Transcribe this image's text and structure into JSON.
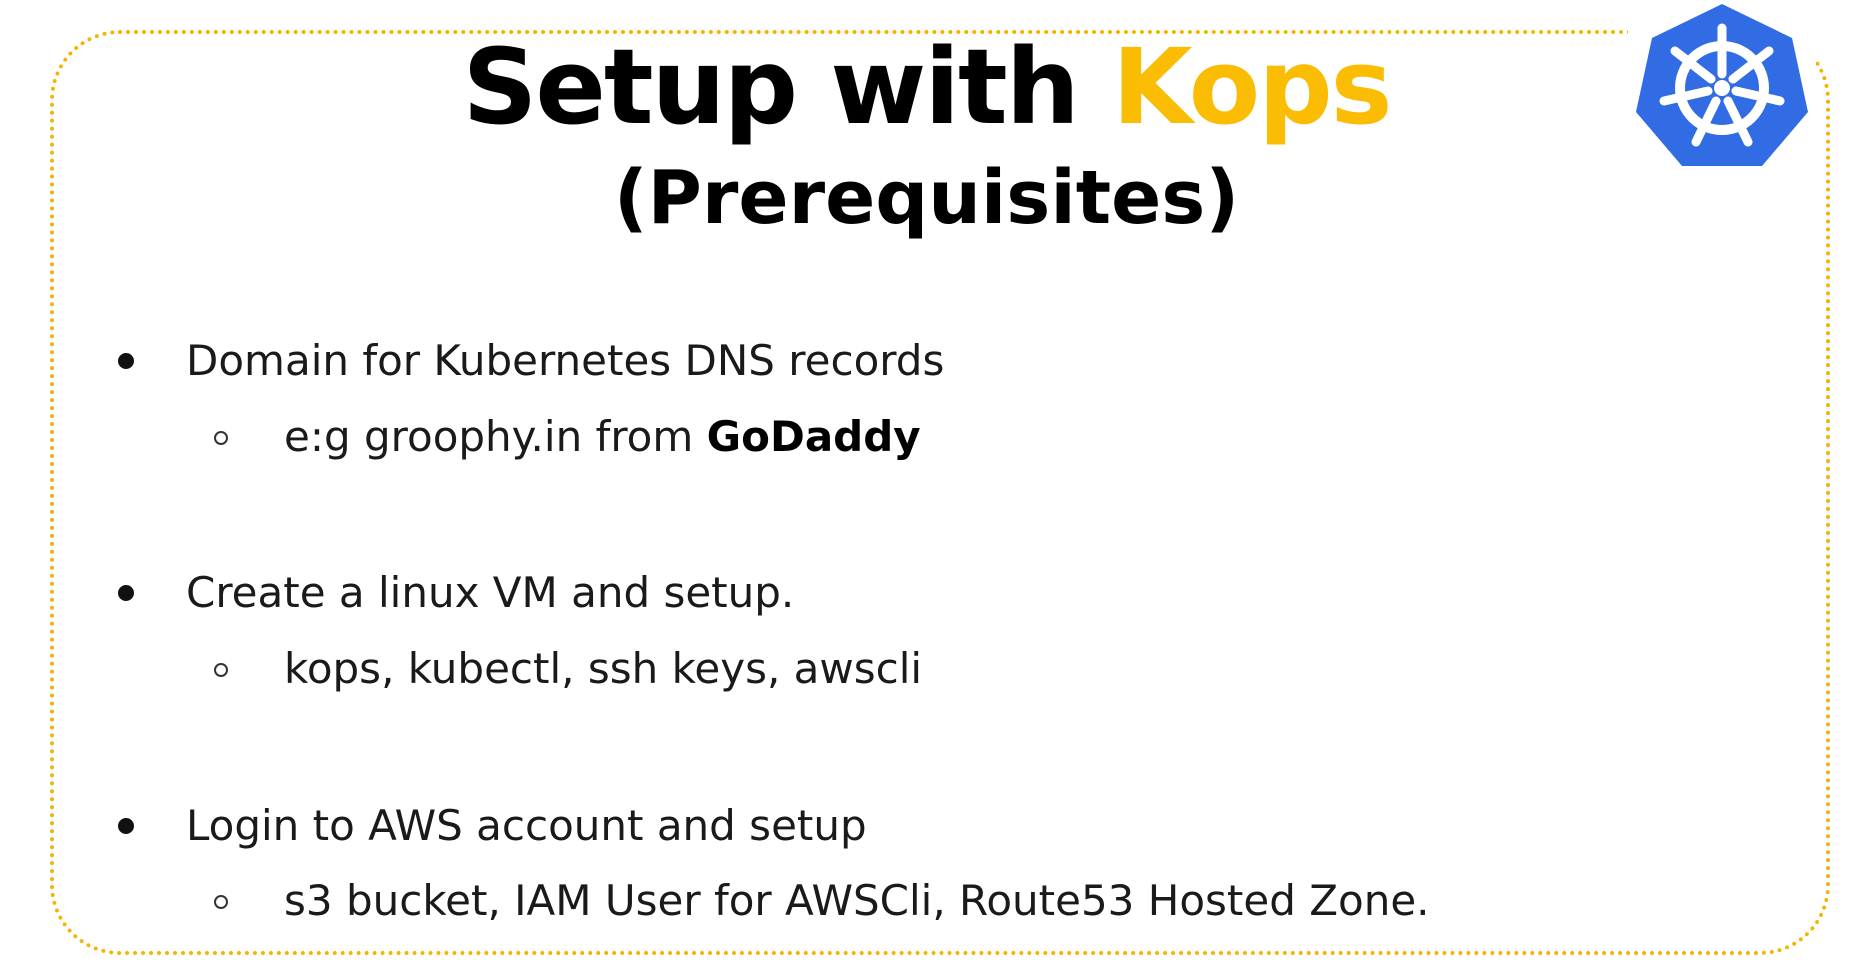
{
  "slide": {
    "title_main": "Setup with ",
    "title_accent": "Kops",
    "subtitle": "(Prerequisites)",
    "accent_color": "#fbbc04",
    "frame_color": "#f5b400",
    "logo_icon": "kubernetes-helm-wheel-icon",
    "logo_color": "#326ce5"
  },
  "bullets": [
    {
      "text": "Domain for Kubernetes DNS records",
      "sub": {
        "text": "e:g groophy.in from ",
        "strong": "GoDaddy"
      }
    },
    {
      "text": "Create a linux VM and setup.",
      "sub": {
        "text": "kops, kubectl, ssh keys, awscli"
      }
    },
    {
      "text": "Login to AWS account and setup",
      "sub": {
        "text": "s3 bucket, IAM User for AWSCli, Route53 Hosted Zone."
      }
    }
  ]
}
